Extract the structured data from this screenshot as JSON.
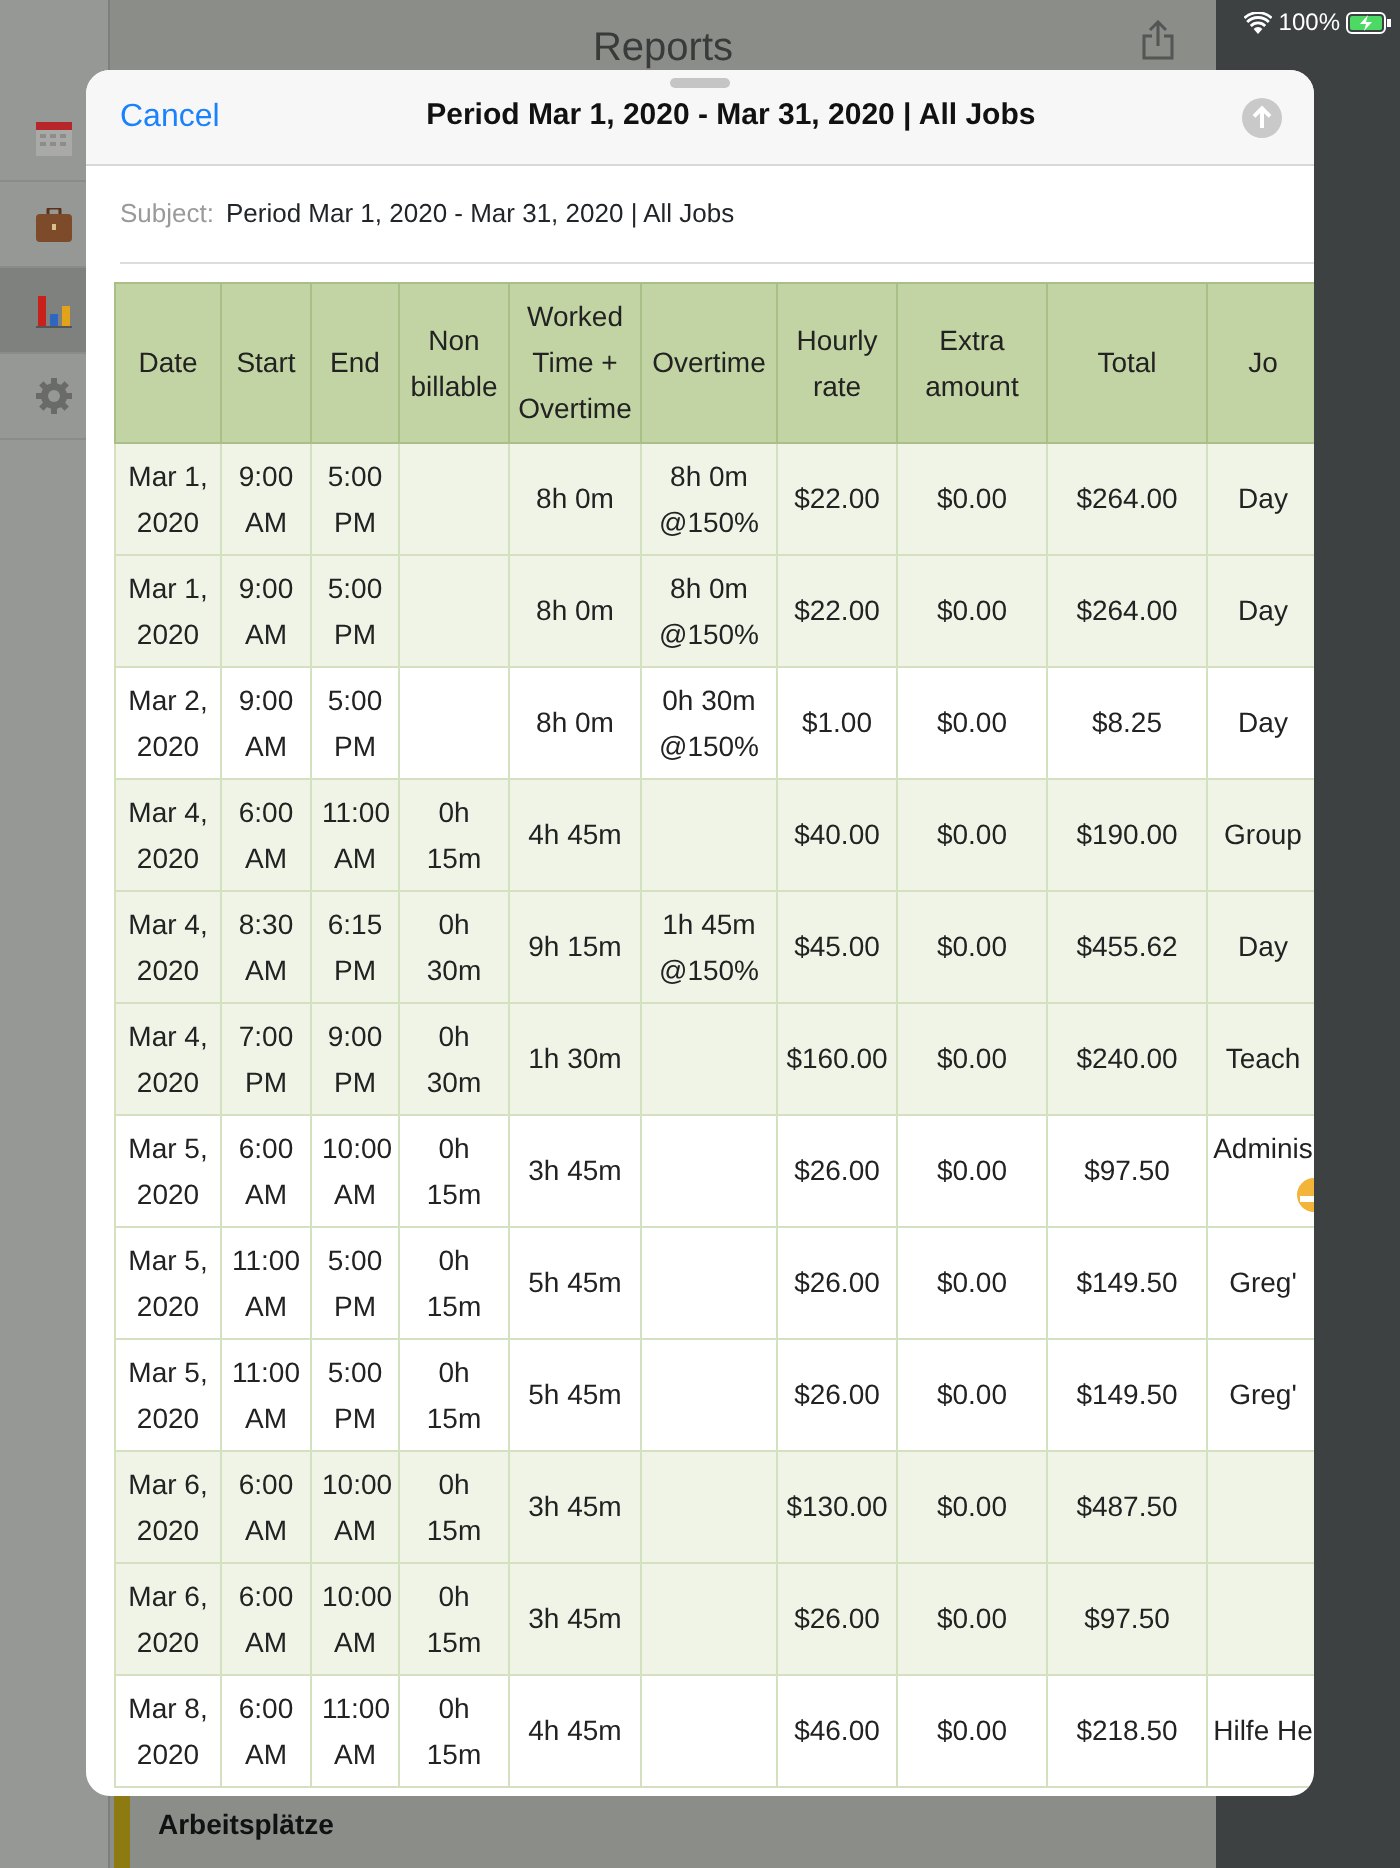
{
  "status_bar": {
    "battery_text": "100%",
    "charging": true
  },
  "sidebar": {
    "items": [
      {
        "kind": "calendar",
        "selected": false
      },
      {
        "kind": "briefcase",
        "selected": false
      },
      {
        "kind": "chart",
        "selected": true
      },
      {
        "kind": "gear",
        "selected": false
      }
    ]
  },
  "background": {
    "title": "Reports",
    "list_heading": "Arbeitsplätze"
  },
  "sheet": {
    "cancel": "Cancel",
    "title": "Period Mar 1, 2020 - Mar 31, 2020 | All Jobs",
    "subject_label": "Subject:",
    "subject": "Period Mar 1, 2020 - Mar 31, 2020 | All Jobs"
  },
  "table": {
    "columns": [
      "Date",
      "Start",
      "End",
      "Non billable",
      "Worked Time + Overtime",
      "Overtime",
      "Hourly rate",
      "Extra amount",
      "Total",
      "Jo"
    ],
    "rows": [
      {
        "shaded": true,
        "emoji": false,
        "cells": [
          "Mar 1, 2020",
          "9:00 AM",
          "5:00 PM",
          "",
          "8h 0m",
          "8h 0m @150%",
          "$22.00",
          "$0.00",
          "$264.00",
          "Day"
        ]
      },
      {
        "shaded": true,
        "emoji": false,
        "cells": [
          "Mar 1, 2020",
          "9:00 AM",
          "5:00 PM",
          "",
          "8h 0m",
          "8h 0m @150%",
          "$22.00",
          "$0.00",
          "$264.00",
          "Day"
        ]
      },
      {
        "shaded": false,
        "emoji": false,
        "cells": [
          "Mar 2, 2020",
          "9:00 AM",
          "5:00 PM",
          "",
          "8h 0m",
          "0h 30m @150%",
          "$1.00",
          "$0.00",
          "$8.25",
          "Day"
        ]
      },
      {
        "shaded": true,
        "emoji": false,
        "cells": [
          "Mar 4, 2020",
          "6:00 AM",
          "11:00 AM",
          "0h 15m",
          "4h 45m",
          "",
          "$40.00",
          "$0.00",
          "$190.00",
          "Group"
        ]
      },
      {
        "shaded": true,
        "emoji": false,
        "cells": [
          "Mar 4, 2020",
          "8:30 AM",
          "6:15 PM",
          "0h 30m",
          "9h 15m",
          "1h 45m @150%",
          "$45.00",
          "$0.00",
          "$455.62",
          "Day"
        ]
      },
      {
        "shaded": true,
        "emoji": false,
        "cells": [
          "Mar 4, 2020",
          "7:00 PM",
          "9:00 PM",
          "0h 30m",
          "1h 30m",
          "",
          "$160.00",
          "$0.00",
          "$240.00",
          "Teach"
        ]
      },
      {
        "shaded": false,
        "emoji": true,
        "cells": [
          "Mar 5, 2020",
          "6:00 AM",
          "10:00 AM",
          "0h 15m",
          "3h 45m",
          "",
          "$26.00",
          "$0.00",
          "$97.50",
          "Adminis"
        ]
      },
      {
        "shaded": false,
        "emoji": false,
        "cells": [
          "Mar 5, 2020",
          "11:00 AM",
          "5:00 PM",
          "0h 15m",
          "5h 45m",
          "",
          "$26.00",
          "$0.00",
          "$149.50",
          "Greg'"
        ]
      },
      {
        "shaded": false,
        "emoji": false,
        "cells": [
          "Mar 5, 2020",
          "11:00 AM",
          "5:00 PM",
          "0h 15m",
          "5h 45m",
          "",
          "$26.00",
          "$0.00",
          "$149.50",
          "Greg'"
        ]
      },
      {
        "shaded": true,
        "emoji": false,
        "cells": [
          "Mar 6, 2020",
          "6:00 AM",
          "10:00 AM",
          "0h 15m",
          "3h 45m",
          "",
          "$130.00",
          "$0.00",
          "$487.50",
          ""
        ]
      },
      {
        "shaded": true,
        "emoji": false,
        "cells": [
          "Mar 6, 2020",
          "6:00 AM",
          "10:00 AM",
          "0h 15m",
          "3h 45m",
          "",
          "$26.00",
          "$0.00",
          "$97.50",
          ""
        ]
      },
      {
        "shaded": false,
        "emoji": false,
        "cells": [
          "Mar 8, 2020",
          "6:00 AM",
          "11:00 AM",
          "0h 15m",
          "4h 45m",
          "",
          "$46.00",
          "$0.00",
          "$218.50",
          "Hilfe He"
        ]
      }
    ]
  }
}
